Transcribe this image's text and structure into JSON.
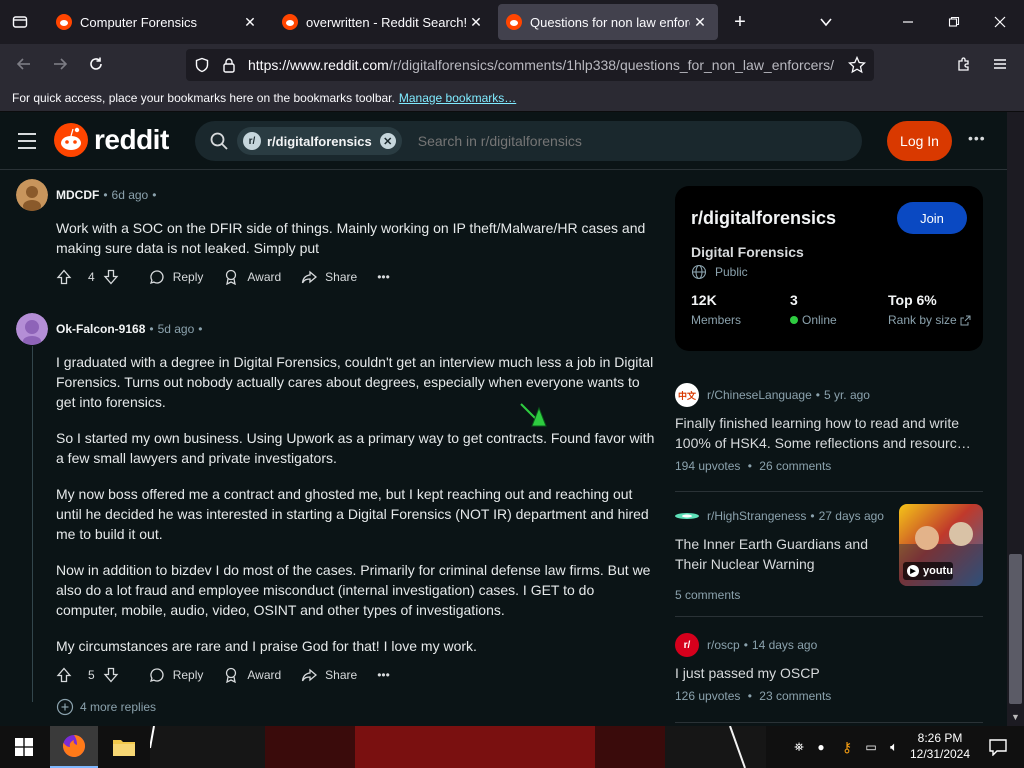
{
  "browser": {
    "tabs": [
      {
        "title": "Computer Forensics",
        "active": false
      },
      {
        "title": "overwritten - Reddit Search!",
        "active": false
      },
      {
        "title": "Questions for non law enforcers",
        "active": true
      }
    ],
    "url_host": "https://www.reddit.com",
    "url_path": "/r/digitalforensics/comments/1hlp338/questions_for_non_law_enforcers/",
    "bookmarks_message": "For quick access, place your bookmarks here on the bookmarks toolbar.",
    "bookmarks_link": "Manage bookmarks…"
  },
  "reddit": {
    "logo_text": "reddit",
    "search_chip": "r/digitalforensics",
    "search_placeholder": "Search in r/digitalforensics",
    "login_label": "Log In",
    "more_label": "•••"
  },
  "comments": [
    {
      "author": "MDCDF",
      "age": "6d ago",
      "paragraphs": [
        "Work with a SOC on the DFIR side of things. Mainly working on IP theft/Malware/HR cases and making sure data is not leaked. Simply put"
      ],
      "votes": "4",
      "avatar_color": "#c8955c"
    },
    {
      "author": "Ok-Falcon-9168",
      "age": "5d ago",
      "paragraphs": [
        "I graduated with a degree in Digital Forensics, couldn't get an interview much less a job in Digital Forensics. Turns out nobody actually cares about degrees, especially when everyone wants to get into forensics.",
        "So I started my own business. Using Upwork as a primary way to get contracts. Found favor with a few small lawyers and private investigators.",
        "My now boss offered me a contract and ghosted me, but I kept reaching out and reaching out until he decided he was interested in starting a Digital Forensics (NOT IR) department and hired me to build it out.",
        "Now in addition to bizdev I do most of the cases. Primarily for criminal defense law firms. But we also do a lot fraud and employee misconduct (internal investigation) cases. I GET to do computer, mobile, audio, video, OSINT and other types of investigations.",
        "My circumstances are rare and I praise God for that! I love my work."
      ],
      "votes": "5",
      "avatar_color": "#b48ed6"
    }
  ],
  "action_labels": {
    "reply": "Reply",
    "award": "Award",
    "share": "Share",
    "more": "•••"
  },
  "more_replies": "4 more replies",
  "sidebar": {
    "sub_name": "r/digitalforensics",
    "join_label": "Join",
    "display_name": "Digital Forensics",
    "visibility": "Public",
    "stats": [
      {
        "value": "12K",
        "label": "Members"
      },
      {
        "value": "3",
        "label": "Online"
      },
      {
        "value": "Top 6%",
        "label": "Rank by size"
      }
    ]
  },
  "recommended": [
    {
      "sub": "r/ChineseLanguage",
      "age": "5 yr. ago",
      "title": "Finally finished learning how to read and write 100% of HSK4. Some reflections and resourc…",
      "upvotes": "194 upvotes",
      "comments": "26 comments",
      "icon_text": "中文"
    },
    {
      "sub": "r/HighStrangeness",
      "age": "27 days ago",
      "title": "The Inner Earth Guardians and Their Nuclear Warning",
      "upvotes": "",
      "comments": "5 comments",
      "thumb_label": "youtu"
    },
    {
      "sub": "r/oscp",
      "age": "14 days ago",
      "title": "I just passed my OSCP",
      "upvotes": "126 upvotes",
      "comments": "23 comments",
      "icon_text": "r/"
    }
  ],
  "taskbar": {
    "time": "8:26 PM",
    "date": "12/31/2024"
  },
  "colors": {
    "reddit_orange": "#ff4500",
    "login_bg": "#d93900",
    "join_bg": "#0a49c2",
    "page_bg": "#0b1416",
    "online_dot": "#2ecc40"
  }
}
